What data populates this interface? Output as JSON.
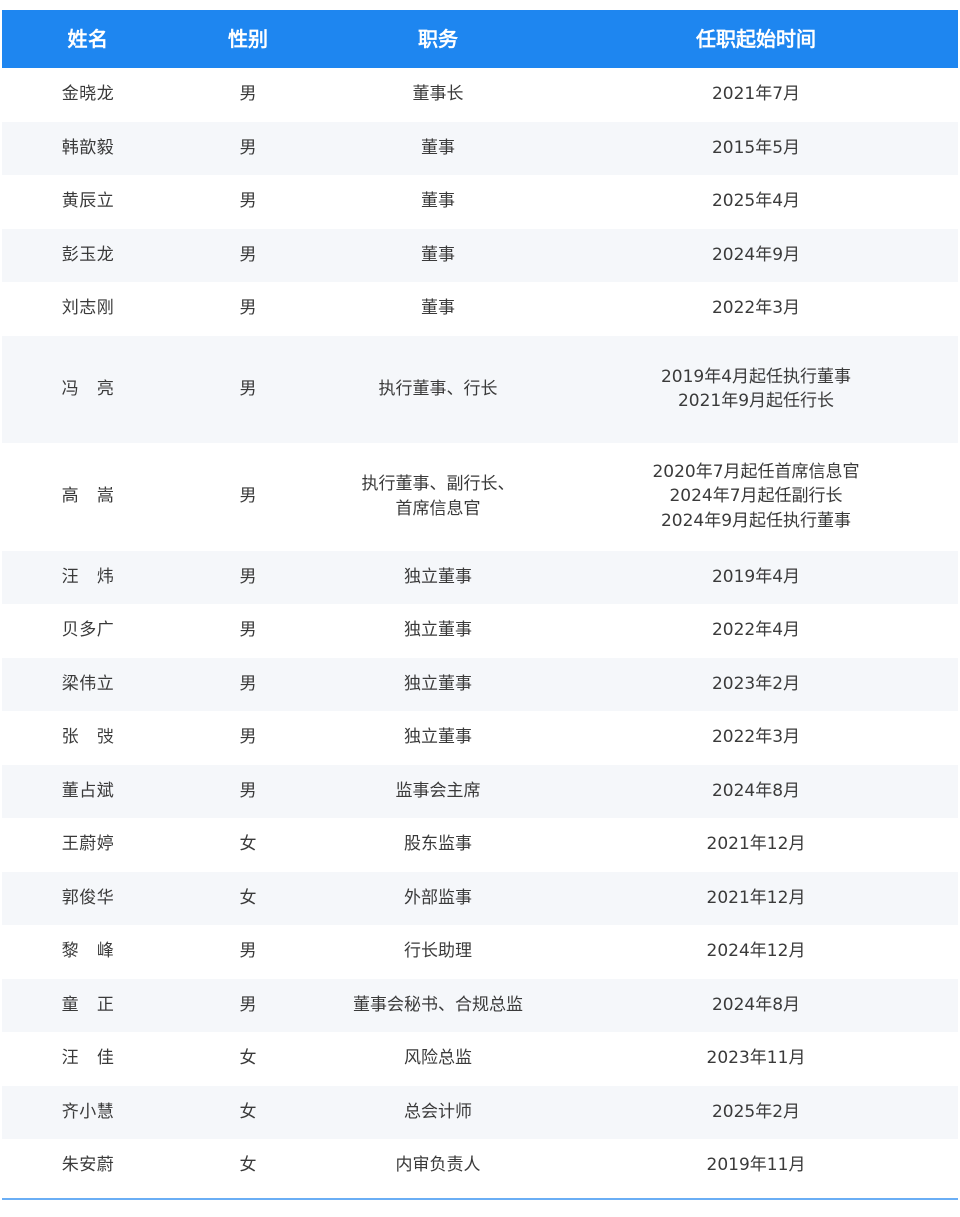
{
  "table": {
    "headers": {
      "name": "姓名",
      "gender": "性别",
      "position": "职务",
      "start": "任职起始时间"
    },
    "rows": [
      {
        "name": "金晓龙",
        "gender": "男",
        "position": "董事长",
        "start": "2021年7月"
      },
      {
        "name": "韩歆毅",
        "gender": "男",
        "position": "董事",
        "start": "2015年5月"
      },
      {
        "name": "黄辰立",
        "gender": "男",
        "position": "董事",
        "start": "2025年4月"
      },
      {
        "name": "彭玉龙",
        "gender": "男",
        "position": "董事",
        "start": "2024年9月"
      },
      {
        "name": "刘志刚",
        "gender": "男",
        "position": "董事",
        "start": "2022年3月"
      },
      {
        "name": "冯   亮",
        "gender": "男",
        "position": "执行董事、行长",
        "start": "2019年4月起任执行董事\n2021年9月起任行长"
      },
      {
        "name": "高   嵩",
        "gender": "男",
        "position": "执行董事、副行长、\n首席信息官",
        "start": "2020年7月起任首席信息官\n2024年7月起任副行长\n2024年9月起任执行董事"
      },
      {
        "name": "汪   炜",
        "gender": "男",
        "position": "独立董事",
        "start": "2019年4月"
      },
      {
        "name": "贝多广",
        "gender": "男",
        "position": "独立董事",
        "start": "2022年4月"
      },
      {
        "name": "梁伟立",
        "gender": "男",
        "position": "独立董事",
        "start": "2023年2月"
      },
      {
        "name": "张   弢",
        "gender": "男",
        "position": "独立董事",
        "start": "2022年3月"
      },
      {
        "name": "董占斌",
        "gender": "男",
        "position": "监事会主席",
        "start": "2024年8月"
      },
      {
        "name": "王蔚婷",
        "gender": "女",
        "position": "股东监事",
        "start": "2021年12月"
      },
      {
        "name": "郭俊华",
        "gender": "女",
        "position": "外部监事",
        "start": "2021年12月"
      },
      {
        "name": "黎   峰",
        "gender": "男",
        "position": "行长助理",
        "start": "2024年12月"
      },
      {
        "name": "童   正",
        "gender": "男",
        "position": "董事会秘书、合规总监",
        "start": "2024年8月"
      },
      {
        "name": "汪   佳",
        "gender": "女",
        "position": "风险总监",
        "start": "2023年11月"
      },
      {
        "name": "齐小慧",
        "gender": "女",
        "position": "总会计师",
        "start": "2025年2月"
      },
      {
        "name": "朱安蔚",
        "gender": "女",
        "position": "内审负责人",
        "start": "2019年11月"
      }
    ]
  },
  "colors": {
    "header_bg": "#1e86f0",
    "header_text": "#ffffff",
    "alt_row_bg": "#f5f7fa",
    "text": "#3a3a3a",
    "bottom_rule": "#6aaef5"
  }
}
